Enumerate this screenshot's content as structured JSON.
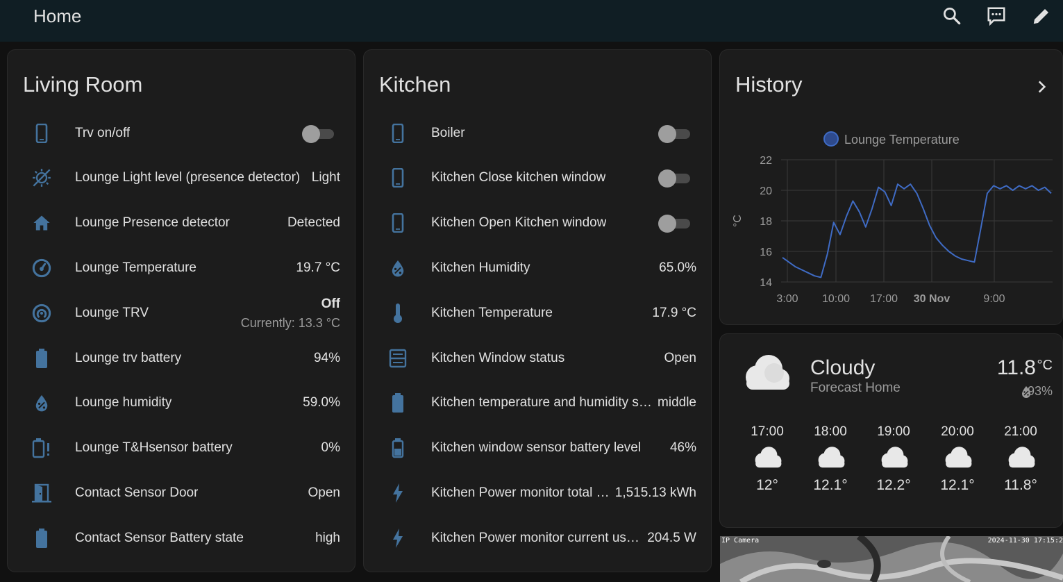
{
  "app": {
    "title": "Home"
  },
  "toolbar": {
    "search_icon": "search-icon",
    "assist_icon": "assist-icon",
    "edit_icon": "pencil-icon"
  },
  "living_room": {
    "title": "Living Room",
    "rows": [
      {
        "icon": "phone-icon",
        "name": "Trv on/off",
        "type": "toggle",
        "on": false
      },
      {
        "icon": "brightness-auto-icon",
        "name": "Lounge Light level (presence detector)",
        "state": "Light"
      },
      {
        "icon": "home-icon",
        "name": "Lounge Presence detector",
        "state": "Detected"
      },
      {
        "icon": "gauge-icon",
        "name": "Lounge Temperature",
        "state": "19.7 °C"
      },
      {
        "icon": "thermostat-dial-icon",
        "name": "Lounge TRV",
        "state": "Off",
        "sub": "Currently: 13.3 °C"
      },
      {
        "icon": "battery-icon",
        "name": "Lounge trv battery",
        "state": "94%"
      },
      {
        "icon": "water-percent-icon",
        "name": "Lounge humidity",
        "state": "59.0%"
      },
      {
        "icon": "battery-alert-icon",
        "name": "Lounge T&Hsensor battery",
        "state": "0%"
      },
      {
        "icon": "door-open-icon",
        "name": "Contact Sensor Door",
        "state": "Open"
      },
      {
        "icon": "battery-icon",
        "name": "Contact Sensor Battery state",
        "state": "high"
      }
    ]
  },
  "kitchen": {
    "title": "Kitchen",
    "rows": [
      {
        "icon": "phone-icon",
        "name": "Boiler",
        "type": "toggle",
        "on": false
      },
      {
        "icon": "phone-icon",
        "name": "Kitchen Close kitchen window",
        "type": "toggle",
        "on": false
      },
      {
        "icon": "phone-icon",
        "name": "Kitchen Open Kitchen window",
        "type": "toggle",
        "on": false
      },
      {
        "icon": "water-percent-icon",
        "name": "Kitchen Humidity",
        "state": "65.0%"
      },
      {
        "icon": "thermometer-icon",
        "name": "Kitchen Temperature",
        "state": "17.9 °C"
      },
      {
        "icon": "window-icon",
        "name": "Kitchen Window status",
        "state": "Open"
      },
      {
        "icon": "battery-icon",
        "name": "Kitchen temperature and humidity s…",
        "state": "middle"
      },
      {
        "icon": "battery-medium-icon",
        "name": "Kitchen window sensor battery level",
        "state": "46%"
      },
      {
        "icon": "flash-icon",
        "name": "Kitchen Power monitor total …",
        "state": "1,515.13 kWh"
      },
      {
        "icon": "flash-outline-icon",
        "name": "Kitchen Power monitor current us…",
        "state": "204.5 W"
      }
    ]
  },
  "history": {
    "title": "History",
    "more_icon": "chevron-right-icon",
    "legend": "Lounge Temperature",
    "series_color": "#3f6bc4",
    "y_unit": "°C",
    "y_ticks": [
      "22",
      "20",
      "18",
      "16",
      "14"
    ],
    "x_ticks": [
      "3:00",
      "10:00",
      "17:00",
      "30 Nov",
      "9:00"
    ],
    "chart_data": {
      "type": "line",
      "ylabel": "°C",
      "ylim": [
        14,
        22
      ],
      "x_labels": [
        "3:00",
        "10:00",
        "17:00",
        "30 Nov",
        "9:00"
      ],
      "series": [
        {
          "name": "Lounge Temperature",
          "values": [
            15.6,
            15.3,
            15.0,
            14.8,
            14.6,
            14.4,
            14.3,
            15.8,
            17.9,
            17.1,
            18.3,
            19.3,
            18.6,
            17.6,
            18.8,
            20.2,
            19.9,
            19.0,
            20.4,
            20.1,
            20.4,
            19.8,
            18.8,
            17.7,
            16.9,
            16.4,
            16.0,
            15.7,
            15.5,
            15.4,
            15.3,
            17.5,
            19.8,
            20.3,
            20.1,
            20.3,
            20.0,
            20.3,
            20.1,
            20.3,
            20.0,
            20.2,
            19.8
          ]
        }
      ]
    }
  },
  "weather": {
    "condition": "Cloudy",
    "location": "Forecast Home",
    "temp": "11.8",
    "unit": "°C",
    "humidity": "93%",
    "forecast": [
      {
        "time": "17:00",
        "temp": "12°"
      },
      {
        "time": "18:00",
        "temp": "12.1°"
      },
      {
        "time": "19:00",
        "temp": "12.2°"
      },
      {
        "time": "20:00",
        "temp": "12.1°"
      },
      {
        "time": "21:00",
        "temp": "11.8°"
      }
    ]
  },
  "camera": {
    "label": "IP Camera",
    "timestamp": "2024-11-30 17:15:2"
  },
  "colors": {
    "icon": "#44739e",
    "background": "#111111",
    "card": "#1c1c1c",
    "header": "#101e24"
  }
}
